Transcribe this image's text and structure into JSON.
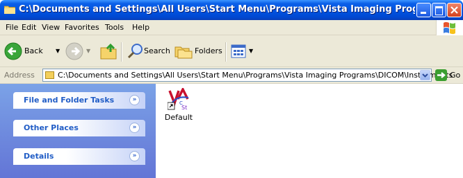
{
  "window": {
    "title": "C:\\Documents and Settings\\All Users\\Start Menu\\Programs\\Vista Imaging Programs\\DICOM..."
  },
  "menu": [
    "File",
    "Edit",
    "View",
    "Favorites",
    "Tools",
    "Help"
  ],
  "toolbar": {
    "back_label": "Back",
    "search_label": "Search",
    "folders_label": "Folders"
  },
  "address": {
    "label": "Address",
    "path": "C:\\Documents and Settings\\All Users\\Start Menu\\Programs\\Vista Imaging Programs\\DICOM\\Instruments",
    "go_label": "Go"
  },
  "taskpane": {
    "sections": [
      "File and Folder Tasks",
      "Other Places",
      "Details"
    ]
  },
  "files": [
    {
      "name": "Default",
      "icon": "vista-shortcut-icon"
    }
  ]
}
